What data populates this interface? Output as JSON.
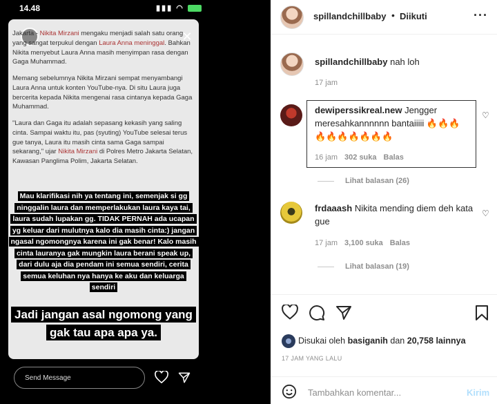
{
  "status_bar": {
    "time": "14.48"
  },
  "story": {
    "article_p1_a": "Jakarta - ",
    "article_p1_link1": "Nikita Mirzani",
    "article_p1_b": " mengaku menjadi salah satu orang yang sangat terpukul dengan ",
    "article_p1_link2": "Laura Anna meninggal",
    "article_p1_c": ". Bahkan Nikita menyebut Laura Anna masih menyimpan rasa dengan Gaga Muhammad.",
    "article_p2": "Memang sebelumnya Nikita Mirzani sempat menyambangi Laura Anna untuk konten YouTube-nya. Di situ Laura juga bercerita kepada Nikita mengenai rasa cintanya kepada Gaga Muhammad.",
    "article_p3_a": "\"Laura dan Gaga itu adalah sepasang kekasih yang saling cinta. Sampai waktu itu, pas (syuting) YouTube selesai terus gue tanya, Laura itu masih cinta sama Gaga sampai sekarang,\" ujar ",
    "article_p3_link": "Nikita Mirzani",
    "article_p3_b": " di Polres Metro Jakarta Selatan, Kawasan Panglima Polim, Jakarta Selatan.",
    "highlight_1": "Mau klarifikasi nih ya tentang ini, semenjak si gg ninggalin laura dan memperlakukan laura kaya tai, laura sudah lupakan gg. TIDAK PERNAH ada ucapan yg keluar dari mulutnya kalo dia masih cinta:) jangan ngasal ngomongnya karena ini gak benar! Kalo masih cinta lauranya gak mungkin laura berani speak up, dari dulu aja dia pendam ini semua sendiri, cerita semua keluhan nya hanya ke aku dan keluarga sendiri",
    "highlight_2": "Jadi jangan asal ngomong yang gak tau apa apa ya.",
    "send_placeholder": "Send Message"
  },
  "post": {
    "username": "spillandchillbaby",
    "follow_state": "Diikuti",
    "caption_user": "spillandchillbaby",
    "caption_text": "nah loh",
    "caption_time": "17 jam",
    "comments": [
      {
        "user": "dewiperssikreal.new",
        "text": "Jengger meresahkannnnnn bantaiiiii 🔥🔥🔥🔥🔥🔥🔥🔥🔥🔥",
        "time": "16 jam",
        "likes": "302 suka",
        "reply": "Balas",
        "view_replies": "Lihat balasan (26)"
      },
      {
        "user": "frdaaash",
        "text": "Nikita mending diem deh kata gue",
        "time": "17 jam",
        "likes": "3,100 suka",
        "reply": "Balas",
        "view_replies": "Lihat balasan (19)"
      }
    ],
    "liked_by_prefix": "Disukai oleh",
    "liked_by_user": "basiganih",
    "liked_by_mid": "dan",
    "liked_by_count": "20,758 lainnya",
    "time_ago": "17 JAM YANG LALU",
    "add_comment_placeholder": "Tambahkan komentar...",
    "post_button": "Kirim"
  },
  "icons": [
    "heart-icon",
    "comment-icon",
    "share-icon",
    "bookmark-icon",
    "smile-icon",
    "more-icon"
  ]
}
